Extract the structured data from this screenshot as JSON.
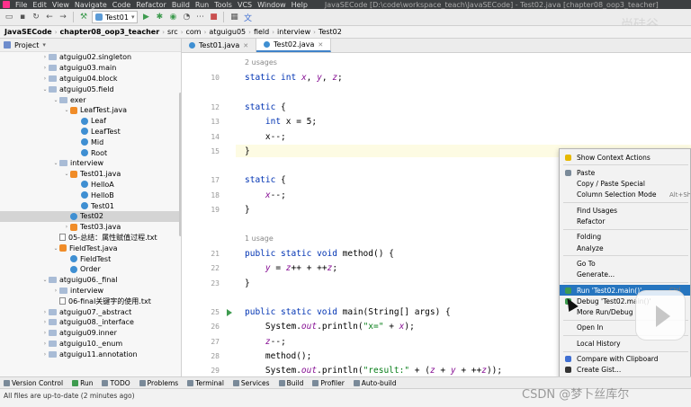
{
  "menubar": {
    "items": [
      "File",
      "Edit",
      "View",
      "Navigate",
      "Code",
      "Refactor",
      "Build",
      "Run",
      "Tools",
      "VCS",
      "Window",
      "Help"
    ],
    "window_title": "JavaSECode [D:\\code\\workspace_teach\\JavaSECode] - Test02.java [chapter08_oop3_teacher]"
  },
  "toolbar": {
    "run_config": "Test01"
  },
  "breadcrumb": [
    "JavaSECode",
    "chapter08_oop3_teacher",
    "src",
    "com",
    "atguigu05",
    "field",
    "interview",
    "Test02"
  ],
  "project": {
    "title": "Project",
    "tree": [
      {
        "label": "atguigu02.singleton",
        "kind": "folder",
        "arrow": "›",
        "indent": 0
      },
      {
        "label": "atguigu03.main",
        "kind": "folder",
        "arrow": "›",
        "indent": 0
      },
      {
        "label": "atguigu04.block",
        "kind": "folder",
        "arrow": "›",
        "indent": 0
      },
      {
        "label": "atguigu05.field",
        "kind": "folder",
        "arrow": "⌄",
        "indent": 0
      },
      {
        "label": "exer",
        "kind": "folder",
        "arrow": "⌄",
        "indent": 1
      },
      {
        "label": "LeafTest.java",
        "kind": "jfile",
        "arrow": "⌄",
        "indent": 2
      },
      {
        "label": "Leaf",
        "kind": "cls",
        "arrow": "",
        "indent": 3
      },
      {
        "label": "LeafTest",
        "kind": "cls",
        "arrow": "",
        "indent": 3
      },
      {
        "label": "Mid",
        "kind": "cls",
        "arrow": "",
        "indent": 3
      },
      {
        "label": "Root",
        "kind": "cls",
        "arrow": "",
        "indent": 3
      },
      {
        "label": "interview",
        "kind": "folder",
        "arrow": "⌄",
        "indent": 1
      },
      {
        "label": "Test01.java",
        "kind": "jfile",
        "arrow": "⌄",
        "indent": 2
      },
      {
        "label": "HelloA",
        "kind": "cls",
        "arrow": "",
        "indent": 3
      },
      {
        "label": "HelloB",
        "kind": "cls",
        "arrow": "",
        "indent": 3
      },
      {
        "label": "Test01",
        "kind": "cls",
        "arrow": "",
        "indent": 3
      },
      {
        "label": "Test02",
        "kind": "cls",
        "arrow": "",
        "indent": 2,
        "selected": true
      },
      {
        "label": "Test03.java",
        "kind": "jfile",
        "arrow": "›",
        "indent": 2
      },
      {
        "label": "05-总结：属性赋值过程.txt",
        "kind": "txt",
        "arrow": "",
        "indent": 1
      },
      {
        "label": "FieldTest.java",
        "kind": "jfile",
        "arrow": "⌄",
        "indent": 1
      },
      {
        "label": "FieldTest",
        "kind": "cls",
        "arrow": "",
        "indent": 2
      },
      {
        "label": "Order",
        "kind": "cls",
        "arrow": "",
        "indent": 2
      },
      {
        "label": "atguigu06._final",
        "kind": "folder",
        "arrow": "⌄",
        "indent": 0
      },
      {
        "label": "interview",
        "kind": "folder",
        "arrow": "›",
        "indent": 1
      },
      {
        "label": "06-final关键字的使用.txt",
        "kind": "txt",
        "arrow": "",
        "indent": 1
      },
      {
        "label": "atguigu07._abstract",
        "kind": "folder",
        "arrow": "›",
        "indent": 0
      },
      {
        "label": "atguigu08._interface",
        "kind": "folder",
        "arrow": "›",
        "indent": 0
      },
      {
        "label": "atguigu09.inner",
        "kind": "folder",
        "arrow": "›",
        "indent": 0
      },
      {
        "label": "atguigu10._enum",
        "kind": "folder",
        "arrow": "›",
        "indent": 0
      },
      {
        "label": "atguigu11.annotation",
        "kind": "folder",
        "arrow": "›",
        "indent": 0
      }
    ]
  },
  "tabs": [
    {
      "label": "Test01.java",
      "active": false
    },
    {
      "label": "Test02.java",
      "active": true
    }
  ],
  "editor": {
    "lines": [
      {
        "type": "usage",
        "text": "2 usages"
      },
      {
        "no": "10",
        "html": "<span class=\"kw\">static int</span> <span class=\"it\">x</span>, <span class=\"it\">y</span>, <span class=\"it\">z</span>;"
      },
      {
        "type": "blank"
      },
      {
        "no": "12",
        "html": "<span class=\"kw\">static</span> {"
      },
      {
        "no": "13",
        "html": "    <span class=\"kw\">int</span> x = 5;"
      },
      {
        "no": "14",
        "html": "    x--;"
      },
      {
        "no": "15",
        "html": "}"
      },
      {
        "type": "blank"
      },
      {
        "no": "17",
        "html": "<span class=\"kw\">static</span> {"
      },
      {
        "no": "18",
        "html": "    <span class=\"it\">x</span>--;"
      },
      {
        "no": "19",
        "html": "}"
      },
      {
        "type": "blank"
      },
      {
        "type": "usage",
        "text": "1 usage"
      },
      {
        "no": "21",
        "html": "<span class=\"kw\">public static void</span> method() {"
      },
      {
        "no": "22",
        "html": "    <span class=\"it\">y</span> = <span class=\"it\">z</span>++ + ++<span class=\"it\">z</span>;"
      },
      {
        "no": "23",
        "html": "}"
      },
      {
        "type": "blank"
      },
      {
        "no": "25",
        "html": "<span class=\"kw\">public static void</span> main(String[] args) {"
      },
      {
        "no": "26",
        "html": "    System.<span class=\"it\">out</span>.println(<span style=\"color:#067d17\">\"x=\"</span> + <span class=\"it\">x</span>);"
      },
      {
        "no": "27",
        "html": "    <span class=\"it\">z</span>--;"
      },
      {
        "no": "28",
        "html": "    method();"
      },
      {
        "no": "29",
        "html": "    System.<span class=\"it\">out</span>.println(<span style=\"color:#067d17\">\"result:\"</span> + (<span class=\"it\">z</span> + <span class=\"it\">y</span> + ++<span class=\"it\">z</span>));"
      }
    ]
  },
  "context_menu": {
    "items": [
      {
        "label": "Show Context Actions",
        "shortcut": "",
        "icon": "bulb"
      },
      {
        "sep": true
      },
      {
        "label": "Paste",
        "shortcut": "",
        "icon": "paste"
      },
      {
        "label": "Copy / Paste Special",
        "shortcut": ""
      },
      {
        "label": "Column Selection Mode",
        "shortcut": "Alt+Sh"
      },
      {
        "sep": true
      },
      {
        "label": "Find Usages",
        "shortcut": ""
      },
      {
        "label": "Refactor",
        "shortcut": ""
      },
      {
        "sep": true
      },
      {
        "label": "Folding",
        "shortcut": ""
      },
      {
        "label": "Analyze",
        "shortcut": ""
      },
      {
        "sep": true
      },
      {
        "label": "Go To",
        "shortcut": ""
      },
      {
        "label": "Generate...",
        "shortcut": ""
      },
      {
        "sep": true
      },
      {
        "label": "Run 'Test02.main()'",
        "shortcut": "Ctrl",
        "icon": "run",
        "highlight": true
      },
      {
        "label": "Debug 'Test02.main()'",
        "shortcut": "",
        "icon": "debug"
      },
      {
        "label": "More Run/Debug",
        "shortcut": ""
      },
      {
        "sep": true
      },
      {
        "label": "Open In",
        "shortcut": ""
      },
      {
        "sep": true
      },
      {
        "label": "Local History",
        "shortcut": ""
      },
      {
        "sep": true
      },
      {
        "label": "Compare with Clipboard",
        "shortcut": "",
        "icon": "compare"
      },
      {
        "label": "Create Gist...",
        "shortcut": "",
        "icon": "github"
      }
    ]
  },
  "bottombar": [
    "Version Control",
    "Run",
    "TODO",
    "Problems",
    "Terminal",
    "Services",
    "Build",
    "Profiler",
    "Auto-build"
  ],
  "status": "All files are up-to-date (2 minutes ago)",
  "watermark_bottom": "CSDN @梦卜丝库尔",
  "watermark_top": "尚硅谷"
}
